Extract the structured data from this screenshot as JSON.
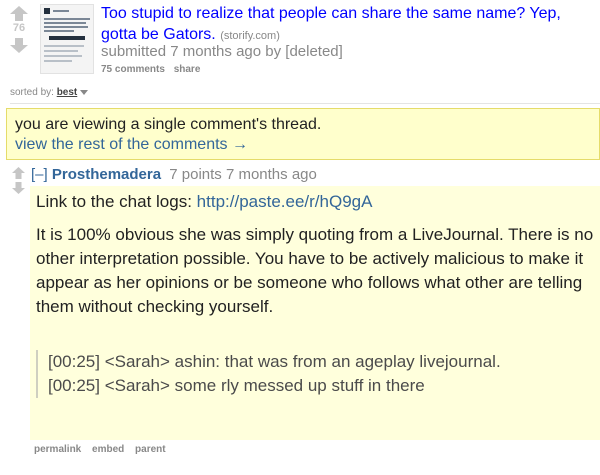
{
  "link": {
    "score": "76",
    "title": "Too stupid to realize that people can share the same name? Yep, gotta be Gators.",
    "domain_open": "(",
    "domain": "storify.com",
    "domain_close": ")",
    "tagline": "submitted 7 months ago by [deleted]",
    "comments_label": "75 comments",
    "share_label": "share"
  },
  "sort": {
    "label": "sorted by:",
    "selected": "best"
  },
  "notice": {
    "line1": "you are viewing a single comment's thread.",
    "line2": "view the rest of the comments →"
  },
  "comment": {
    "toggle": "[–]",
    "author": "Prosthemadera",
    "points_time": "7 points 7 months ago",
    "chat_intro": "Link to the chat logs:",
    "chat_url": "http://paste.ee/r/hQ9gA",
    "paragraph": "It is 100% obvious she was simply quoting from a LiveJournal. There is no other interpretation possible. You have to be actively malicious to make it appear as her opinions or be someone who follows what other are telling them without checking yourself.",
    "quote_line1": "[00:25] <Sarah> ashin: that was from an ageplay livejournal.",
    "quote_line2": "[00:25] <Sarah> some rly messed up stuff in there",
    "buttons": {
      "permalink": "permalink",
      "embed": "embed",
      "parent": "parent"
    }
  },
  "icons": {
    "upvote": "upvote-arrow-icon",
    "downvote": "downvote-arrow-icon"
  },
  "colors": {
    "link": "#0000ff",
    "accent": "#336699",
    "notice_bg": "#ffffcc",
    "comment_bg": "#ffffdc",
    "muted": "#888888"
  }
}
